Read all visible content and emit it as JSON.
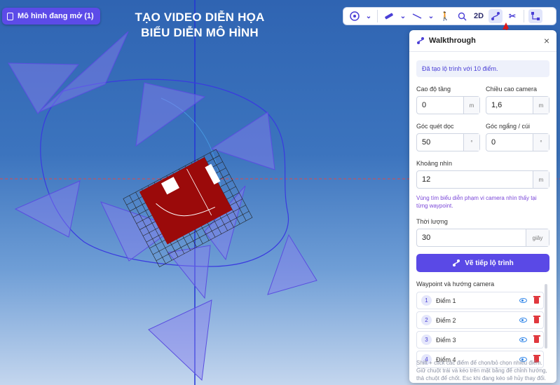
{
  "open_models_label": "Mô hình đang mở (1)",
  "overlay_title_line1": "TẠO VIDEO DIỄN HỌA",
  "overlay_title_line2": "BIỂU DIỄN MÔ HÌNH",
  "toolbar": {
    "mode_2d": "2D"
  },
  "panel": {
    "title": "Walkthrough",
    "close": "×",
    "info": "Đã tạo lộ trình với 10 điểm.",
    "floor_height_label": "Cao độ tầng",
    "floor_height_value": "0",
    "floor_height_unit": "m",
    "camera_height_label": "Chiều cao camera",
    "camera_height_value": "1,6",
    "camera_height_unit": "m",
    "sweep_label": "Góc quét dọc",
    "sweep_value": "50",
    "sweep_unit": "°",
    "tilt_label": "Góc ngẩng / cúi",
    "tilt_value": "0",
    "tilt_unit": "°",
    "distance_label": "Khoảng nhìn",
    "distance_value": "12",
    "distance_unit": "m",
    "hint": "Vùng tím biểu diễn phạm vi camera nhìn thấy tại từng waypoint.",
    "duration_label": "Thời lượng",
    "duration_value": "30",
    "duration_unit": "giây",
    "draw_button": "Vẽ tiếp lộ trình",
    "waypoints_title": "Waypoint và hướng camera",
    "waypoints": [
      {
        "num": "1",
        "name": "Điểm 1"
      },
      {
        "num": "2",
        "name": "Điểm 2"
      },
      {
        "num": "3",
        "name": "Điểm 3"
      },
      {
        "num": "4",
        "name": "Điểm 4"
      }
    ],
    "footer": "Shift + click các điểm để chọn/bỏ chọn nhiều điểm. Giữ chuột trái và kéo trên mặt bằng để chỉnh hướng, thả chuột để chốt. Esc khi đang kéo sẽ hủy thay đổi."
  },
  "colors": {
    "accent": "#5a49e6",
    "building": "#9b0a0a",
    "frustum": "#8a7ff0",
    "axis_red": "#e04040",
    "axis_blue": "#2a3ad8"
  }
}
